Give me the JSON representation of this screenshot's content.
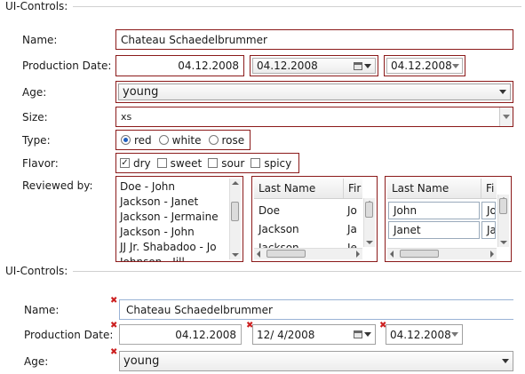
{
  "section1": {
    "title": "UI-Controls:",
    "labels": {
      "name": "Name:",
      "production_date": "Production Date:",
      "age": "Age:",
      "size": "Size:",
      "type": "Type:",
      "flavor": "Flavor:",
      "reviewed_by": "Reviewed by:"
    },
    "name_value": "Chateau Schaedelbrummer",
    "date_text": "04.12.2008",
    "date_picker": "04.12.2008",
    "date_spinner": "04.12.2008",
    "age_value": "young",
    "size_value": "xs",
    "type_options": [
      {
        "label": "red",
        "selected": true
      },
      {
        "label": "white",
        "selected": false
      },
      {
        "label": "rose",
        "selected": false
      }
    ],
    "flavor_options": [
      {
        "label": "dry",
        "checked": true
      },
      {
        "label": "sweet",
        "checked": false
      },
      {
        "label": "sour",
        "checked": false
      },
      {
        "label": "spicy",
        "checked": false
      }
    ],
    "reviewers": [
      "Doe - John",
      "Jackson - Janet",
      "Jackson - Jermaine",
      "Jackson - John",
      "JJ Jr. Shabadoo - Jo",
      "Johnson - Jill"
    ],
    "table1": {
      "columns": [
        "Last Name",
        "Fir"
      ],
      "rows": [
        [
          "Doe",
          "Jo"
        ],
        [
          "Jackson",
          "Ja"
        ],
        [
          "Jackson",
          "Je"
        ]
      ]
    },
    "table2": {
      "columns": [
        "Last Name",
        "Fi"
      ],
      "rows": [
        [
          "John",
          "Jo"
        ],
        [
          "Janet",
          "Ja"
        ]
      ]
    }
  },
  "section2": {
    "title": "UI-Controls:",
    "labels": {
      "name": "Name:",
      "production_date": "Production Date:",
      "age": "Age:"
    },
    "name_value": "Chateau Schaedelbrummer",
    "date_text": "04.12.2008",
    "date_picker": "12/  4/2008",
    "date_spinner": "04.12.2008",
    "age_value": "young",
    "required_marker": "✖"
  },
  "colors": {
    "required_border": "#8b1a1a",
    "required_marker": "#cc2020",
    "selection": "#1f5fbf"
  }
}
